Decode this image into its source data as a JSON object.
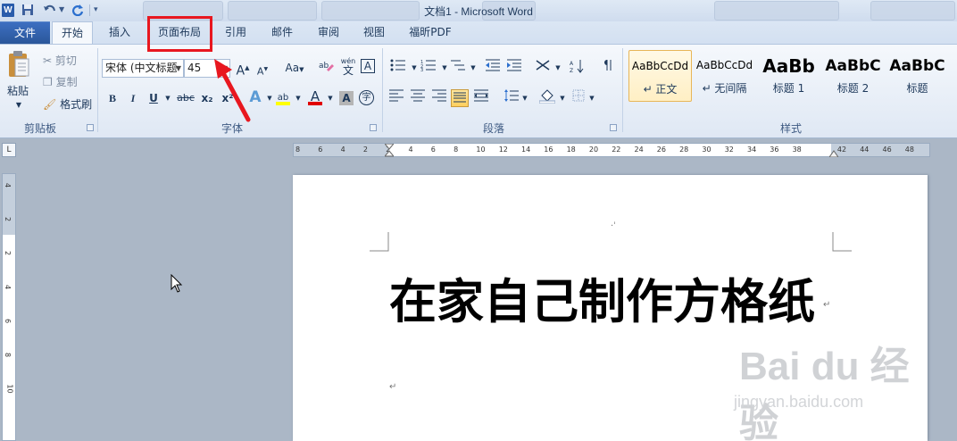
{
  "app": {
    "title": "文档1 - Microsoft Word",
    "app_icon": "W"
  },
  "quick_access": {
    "save_icon": "save-icon",
    "undo_icon": "undo-icon",
    "redo_icon": "redo-icon",
    "customize_icon": "customize-icon"
  },
  "tabs": [
    {
      "label": "文件"
    },
    {
      "label": "开始"
    },
    {
      "label": "插入"
    },
    {
      "label": "页面布局"
    },
    {
      "label": "引用"
    },
    {
      "label": "邮件"
    },
    {
      "label": "审阅"
    },
    {
      "label": "视图"
    },
    {
      "label": "福昕PDF"
    }
  ],
  "clipboard": {
    "paste": "粘贴",
    "cut": "剪切",
    "copy": "复制",
    "format_painter": "格式刷",
    "group": "剪贴板"
  },
  "font": {
    "name": "宋体 (中文标题",
    "size": "45",
    "group": "字体",
    "bold": "B",
    "italic": "I",
    "underline": "U",
    "strike": "abc",
    "subscript": "x₂",
    "superscript": "x²",
    "grow": "A",
    "shrink": "A",
    "change_case": "Aa",
    "phonetic": "wén",
    "phonetic_sub": "文",
    "border_char": "A",
    "enclose": "字",
    "font_color": "A",
    "shade": "A",
    "highlight": "ab"
  },
  "paragraph": {
    "group": "段落"
  },
  "styles": {
    "group": "样式",
    "items": [
      {
        "sample": "AaBbCcDd",
        "name": "↵ 正文"
      },
      {
        "sample": "AaBbCcDd",
        "name": "↵ 无间隔"
      },
      {
        "sample": "AaBb",
        "name": "标题 1"
      },
      {
        "sample": "AaBbC",
        "name": "标题 2"
      },
      {
        "sample": "AaBbC",
        "name": "标题"
      }
    ]
  },
  "ruler": {
    "h_ticks": [
      "8",
      "6",
      "4",
      "2",
      "2",
      "4",
      "6",
      "8",
      "10",
      "12",
      "14",
      "16",
      "18",
      "20",
      "22",
      "24",
      "26",
      "28",
      "30",
      "32",
      "34",
      "36",
      "38",
      "42",
      "44",
      "46",
      "48"
    ],
    "v_ticks": [
      "4",
      "2",
      "2",
      "4",
      "6",
      "8",
      "10"
    ],
    "corner": "L"
  },
  "document": {
    "heading": "在家自己制作方格纸",
    "para_mark": "↵"
  },
  "watermark": {
    "brand": "Bai du 经验",
    "url": "jingyan.baidu.com"
  },
  "colors": {
    "highlight_box": "#e8171f",
    "file_tab": "#2a579a"
  }
}
